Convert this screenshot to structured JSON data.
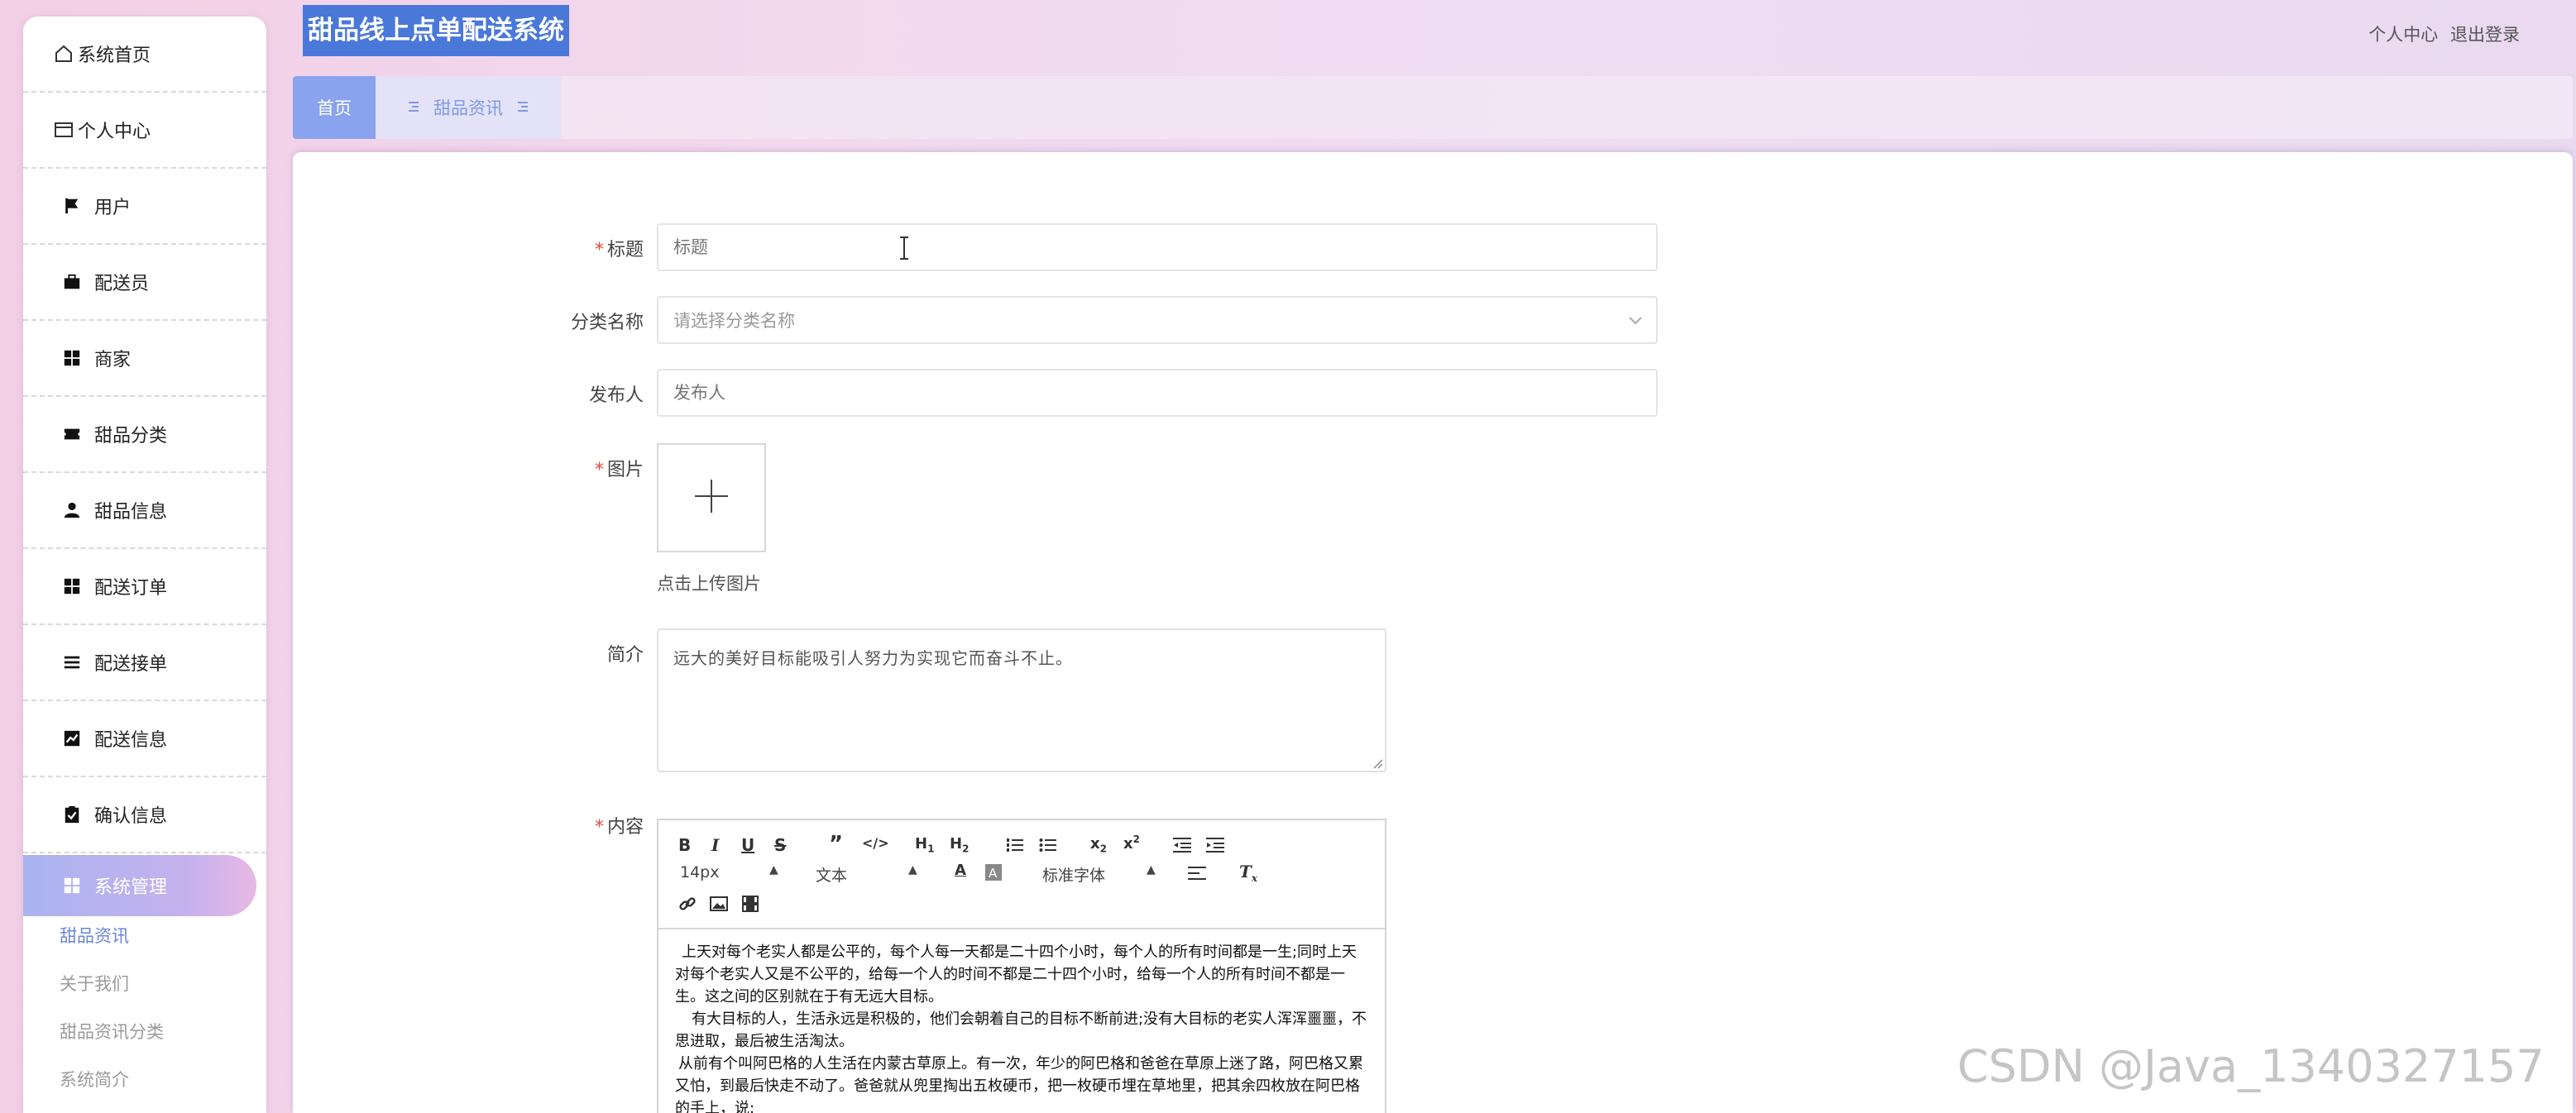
{
  "app": {
    "title": "甜品线上点单配送系统",
    "header_links": [
      "个人中心",
      "退出登录"
    ]
  },
  "sidebar": {
    "items": [
      {
        "label": "系统首页",
        "icon": "home-icon"
      },
      {
        "label": "个人中心",
        "icon": "profile-card-icon"
      },
      {
        "label": "用户",
        "icon": "flag-icon"
      },
      {
        "label": "配送员",
        "icon": "briefcase-icon"
      },
      {
        "label": "商家",
        "icon": "grid-icon"
      },
      {
        "label": "甜品分类",
        "icon": "ticket-icon"
      },
      {
        "label": "甜品信息",
        "icon": "user-icon"
      },
      {
        "label": "配送订单",
        "icon": "grid-icon"
      },
      {
        "label": "配送接单",
        "icon": "list-icon"
      },
      {
        "label": "配送信息",
        "icon": "chart-icon"
      },
      {
        "label": "确认信息",
        "icon": "clipboard-check-icon"
      },
      {
        "label": "系统管理",
        "icon": "grid-icon",
        "active": true
      }
    ],
    "sub_items": [
      "甜品资讯",
      "关于我们",
      "甜品资讯分类",
      "系统简介"
    ]
  },
  "tabs": {
    "home": "首页",
    "current": "甜品资讯"
  },
  "form": {
    "title_label": "标题",
    "title_placeholder": "标题",
    "category_label": "分类名称",
    "category_placeholder": "请选择分类名称",
    "publisher_label": "发布人",
    "publisher_placeholder": "发布人",
    "image_label": "图片",
    "upload_hint": "点击上传图片",
    "intro_label": "简介",
    "intro_value": "远大的美好目标能吸引人努力为实现它而奋斗不止。",
    "content_label": "内容"
  },
  "editor": {
    "font_size": "14px",
    "text_style": "文本",
    "font_family": "标准字体",
    "paragraphs": [
      "上天对每个老实人都是公平的，每个人每一天都是二十四个小时，每个人的所有时间都是一生;同时上天对每个老实人又是不公平的，给每一个人的时间不都是二十四个小时，给每一个人的所有时间不都是一生。这之间的区别就在于有无远大目标。",
      "有大目标的人，生活永远是积极的，他们会朝着自己的目标不断前进;没有大目标的老实人浑浑噩噩，不思进取，最后被生活淘汰。",
      "从前有个叫阿巴格的人生活在内蒙古草原上。有一次，年少的阿巴格和爸爸在草原上迷了路，阿巴格又累又怕，到最后快走不动了。爸爸就从兜里掏出五枚硬币，把一枚硬币埋在草地里，把其余四枚放在阿巴格的手上，说:"
    ]
  },
  "watermark": "CSDN @Java_1340327157",
  "colors": {
    "accent": "#8aa3ee",
    "title_bg": "#4a78d8",
    "required": "#e8443a"
  }
}
